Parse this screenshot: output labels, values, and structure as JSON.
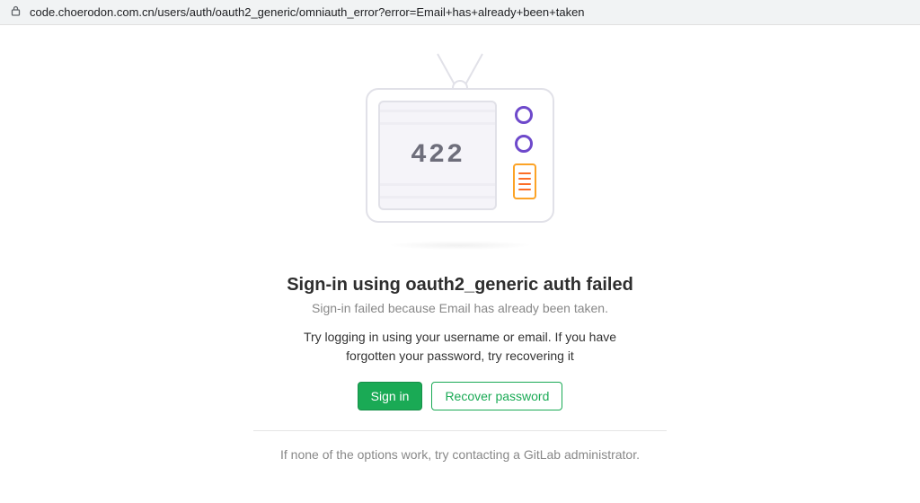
{
  "address_bar": {
    "url": "code.choerodon.com.cn/users/auth/oauth2_generic/omniauth_error?error=Email+has+already+been+taken"
  },
  "error": {
    "code": "422"
  },
  "page": {
    "title": "Sign-in using oauth2_generic auth failed",
    "subtitle": "Sign-in failed because Email has already been taken.",
    "help_text": "Try logging in using your username or email. If you have forgotten your password, try recovering it"
  },
  "buttons": {
    "sign_in": "Sign in",
    "recover": "Recover password"
  },
  "footer": {
    "text": "If none of the options work, try contacting a GitLab administrator."
  }
}
